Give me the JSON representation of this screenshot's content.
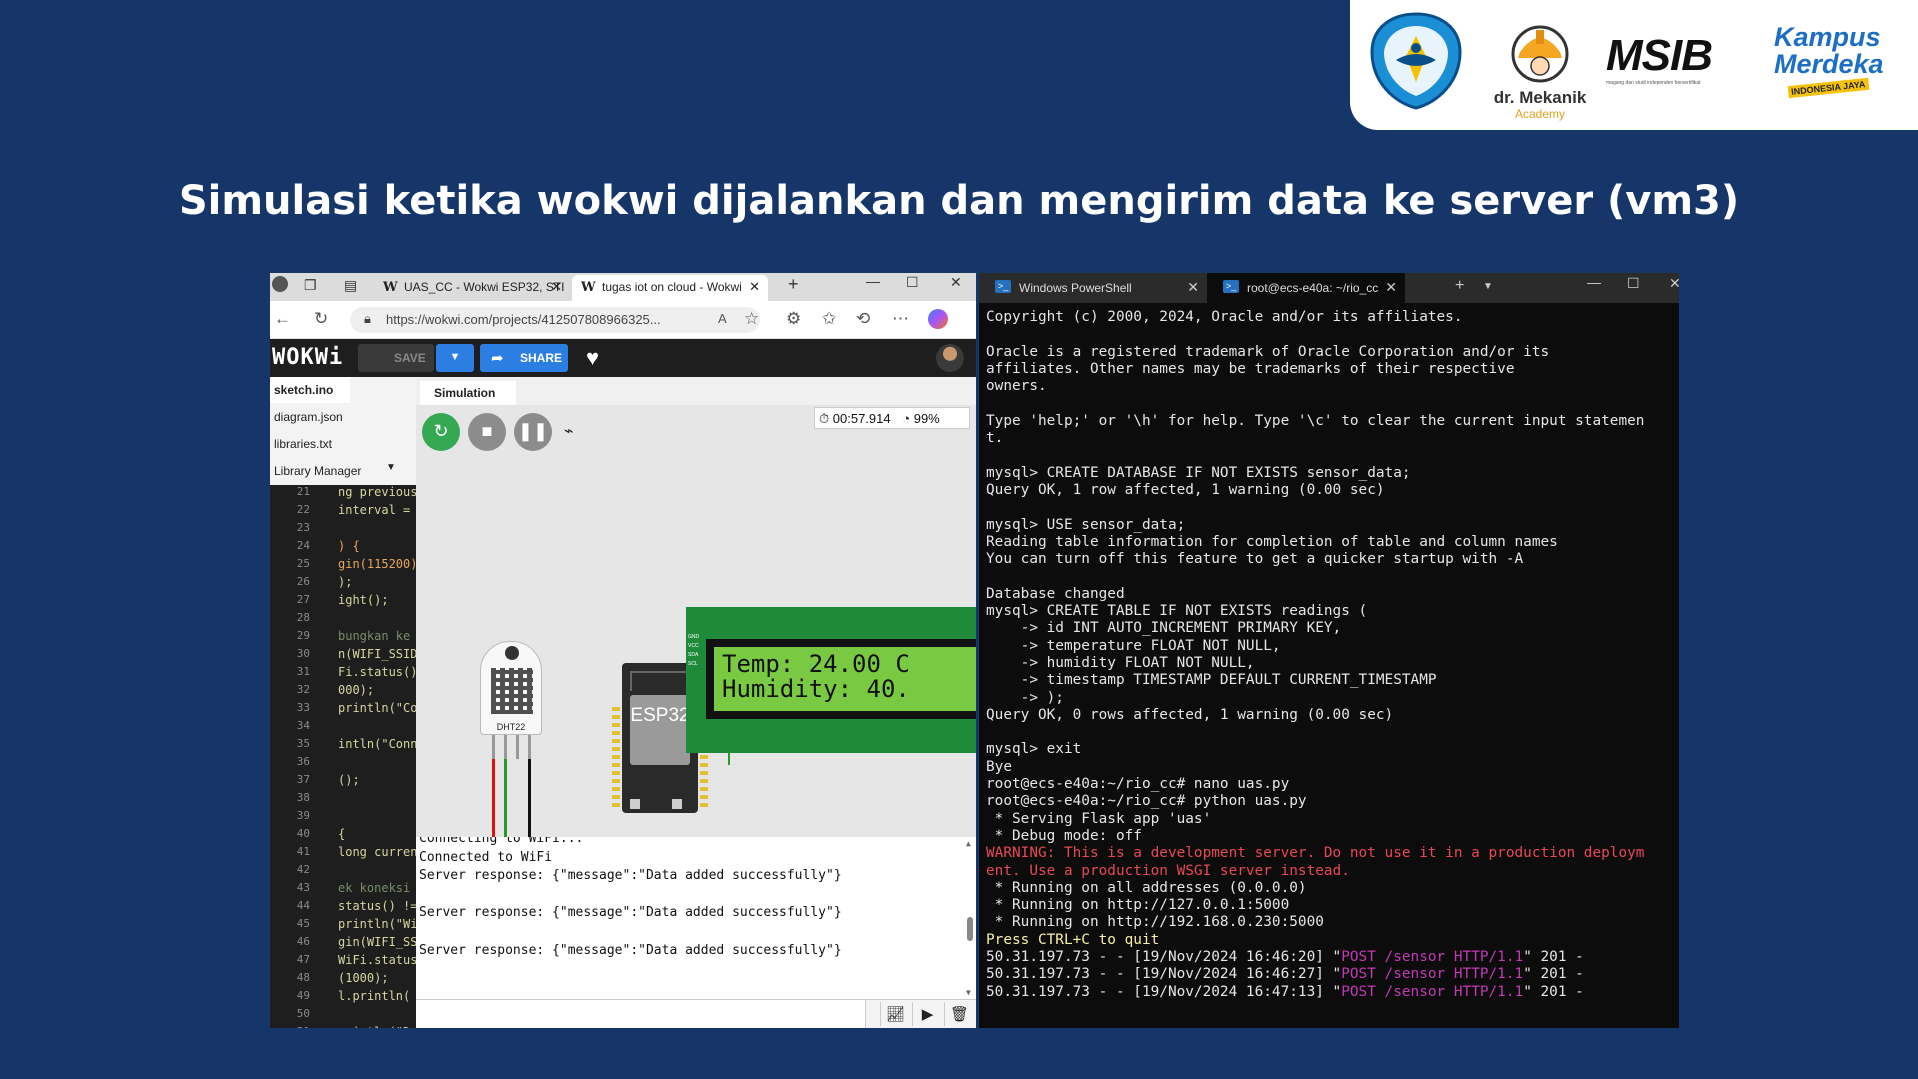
{
  "logos": {
    "tut_wuri": "Tut Wuri Handayani",
    "drmekanik_name": "dr. Mekanik",
    "drmekanik_sub": "Academy",
    "msib": "MSIB",
    "msib_sub": "magang dan studi independen bersertifikat",
    "km_line1": "Kampus",
    "km_line2": "Merdeka",
    "km_line3": "INDONESIA JAYA"
  },
  "slide_title": "Simulasi ketika wokwi dijalankan dan mengirim data ke server (vm3)",
  "browser": {
    "tabs": [
      {
        "label": "UAS_CC - Wokwi ESP32, STI",
        "active": false
      },
      {
        "label": "tugas iot on cloud - Wokwi",
        "active": true
      }
    ],
    "url": "https://wokwi.com/projects/412507808966325...",
    "wokwi": {
      "logo": "WOKWi",
      "save_label": "SAVE",
      "share_label": "SHARE",
      "files": [
        "sketch.ino",
        "diagram.json",
        "libraries.txt",
        "Library Manager"
      ],
      "sim_tab": "Simulation",
      "timer": "00:57.914",
      "speed": "99%",
      "code_lines": [
        {
          "n": "21",
          "t": "ng previous",
          "s": ""
        },
        {
          "n": "22",
          "t": "interval =",
          "s": ""
        },
        {
          "n": "23",
          "t": "",
          "s": ""
        },
        {
          "n": "24",
          "t": ") {",
          "s": "k"
        },
        {
          "n": "25",
          "t": "gin(115200)",
          "s": "k"
        },
        {
          "n": "26",
          "t": ");",
          "s": ""
        },
        {
          "n": "27",
          "t": "ight();",
          "s": ""
        },
        {
          "n": "28",
          "t": "",
          "s": ""
        },
        {
          "n": "29",
          "t": "bungkan ke",
          "s": "c"
        },
        {
          "n": "30",
          "t": "n(WIFI_SSID",
          "s": ""
        },
        {
          "n": "31",
          "t": "Fi.status()",
          "s": ""
        },
        {
          "n": "32",
          "t": "000);",
          "s": ""
        },
        {
          "n": "33",
          "t": "println(\"Co",
          "s": ""
        },
        {
          "n": "34",
          "t": "",
          "s": ""
        },
        {
          "n": "35",
          "t": "intln(\"Conn",
          "s": ""
        },
        {
          "n": "36",
          "t": "",
          "s": ""
        },
        {
          "n": "37",
          "t": "();",
          "s": ""
        },
        {
          "n": "38",
          "t": "",
          "s": ""
        },
        {
          "n": "39",
          "t": "",
          "s": ""
        },
        {
          "n": "40",
          "t": " {",
          "s": ""
        },
        {
          "n": "41",
          "t": "long curren",
          "s": ""
        },
        {
          "n": "42",
          "t": "",
          "s": ""
        },
        {
          "n": "43",
          "t": "ek koneksi",
          "s": "c"
        },
        {
          "n": "44",
          "t": "status() !=",
          "s": ""
        },
        {
          "n": "45",
          "t": "println(\"Wi",
          "s": ""
        },
        {
          "n": "46",
          "t": "gin(WIFI_SS",
          "s": ""
        },
        {
          "n": "47",
          "t": "WiFi.status",
          "s": ""
        },
        {
          "n": "48",
          "t": "(1000);",
          "s": ""
        },
        {
          "n": "49",
          "t": "l.println(",
          "s": ""
        },
        {
          "n": "50",
          "t": "",
          "s": ""
        },
        {
          "n": "51",
          "t": "println(\"D",
          "s": ""
        }
      ],
      "dht_label": "DHT22",
      "esp_label": "ESP32",
      "lcd_line1": "Temp: 24.00 C",
      "lcd_line2": "Humidity: 40.",
      "lcd_pins": [
        "GND",
        "VCC",
        "SDA",
        "SCL"
      ],
      "serial_lines": [
        "Connecting to WiFi...",
        "Connected to WiFi",
        "Server response: {\"message\":\"Data added successfully\"}",
        "",
        "Server response: {\"message\":\"Data added successfully\"}",
        "",
        "Server response: {\"message\":\"Data added successfully\"}"
      ]
    }
  },
  "terminal": {
    "tabs": [
      {
        "label": "Windows PowerShell",
        "active": false
      },
      {
        "label": "root@ecs-e40a: ~/rio_cc",
        "active": true
      }
    ],
    "lines": [
      [
        [
          "Copyright (c) 2000, 2024, Oracle and/or its affiliates.",
          ""
        ]
      ],
      [
        [
          "",
          ""
        ]
      ],
      [
        [
          "Oracle is a registered trademark of Oracle Corporation and/or its",
          ""
        ]
      ],
      [
        [
          "affiliates. Other names may be trademarks of their respective",
          ""
        ]
      ],
      [
        [
          "owners.",
          ""
        ]
      ],
      [
        [
          "",
          ""
        ]
      ],
      [
        [
          "Type 'help;' or '\\h' for help. Type '\\c' to clear the current input statemen",
          ""
        ]
      ],
      [
        [
          "t.",
          ""
        ]
      ],
      [
        [
          "",
          ""
        ]
      ],
      [
        [
          "mysql> CREATE DATABASE IF NOT EXISTS sensor_data;",
          ""
        ]
      ],
      [
        [
          "Query OK, 1 row affected, 1 warning (0.00 sec)",
          ""
        ]
      ],
      [
        [
          "",
          ""
        ]
      ],
      [
        [
          "mysql> USE sensor_data;",
          ""
        ]
      ],
      [
        [
          "Reading table information for completion of table and column names",
          ""
        ]
      ],
      [
        [
          "You can turn off this feature to get a quicker startup with -A",
          ""
        ]
      ],
      [
        [
          "",
          ""
        ]
      ],
      [
        [
          "Database changed",
          ""
        ]
      ],
      [
        [
          "mysql> CREATE TABLE IF NOT EXISTS readings (",
          ""
        ]
      ],
      [
        [
          "    -> id INT AUTO_INCREMENT PRIMARY KEY,",
          ""
        ]
      ],
      [
        [
          "    -> temperature FLOAT NOT NULL,",
          ""
        ]
      ],
      [
        [
          "    -> humidity FLOAT NOT NULL,",
          ""
        ]
      ],
      [
        [
          "    -> timestamp TIMESTAMP DEFAULT CURRENT_TIMESTAMP",
          ""
        ]
      ],
      [
        [
          "    -> );",
          ""
        ]
      ],
      [
        [
          "Query OK, 0 rows affected, 1 warning (0.00 sec)",
          ""
        ]
      ],
      [
        [
          "",
          ""
        ]
      ],
      [
        [
          "mysql> exit",
          ""
        ]
      ],
      [
        [
          "Bye",
          ""
        ]
      ],
      [
        [
          "root@ecs-e40a:~/rio_cc# nano uas.py",
          ""
        ]
      ],
      [
        [
          "root@ecs-e40a:~/rio_cc# python uas.py",
          ""
        ]
      ],
      [
        [
          " * Serving Flask app 'uas'",
          ""
        ]
      ],
      [
        [
          " * Debug mode: off",
          ""
        ]
      ],
      [
        [
          "WARNING: This is a development server. Do not use it in a production deploym",
          "red"
        ]
      ],
      [
        [
          "ent. Use a production WSGI server instead.",
          "red"
        ]
      ],
      [
        [
          " * Running on all addresses (0.0.0.0)",
          ""
        ]
      ],
      [
        [
          " * Running on http://127.0.0.1:5000",
          ""
        ]
      ],
      [
        [
          " * Running on http://192.168.0.230:5000",
          ""
        ]
      ],
      [
        [
          "Press CTRL+C to quit",
          "yel"
        ]
      ],
      [
        [
          "50.31.197.73 - - [19/Nov/2024 16:46:20] \"",
          ""
        ],
        [
          "POST /sensor HTTP/1.1",
          "mag"
        ],
        [
          "\" 201 -",
          ""
        ]
      ],
      [
        [
          "50.31.197.73 - - [19/Nov/2024 16:46:27] \"",
          ""
        ],
        [
          "POST /sensor HTTP/1.1",
          "mag"
        ],
        [
          "\" 201 -",
          ""
        ]
      ],
      [
        [
          "50.31.197.73 - - [19/Nov/2024 16:47:13] \"",
          ""
        ],
        [
          "POST /sensor HTTP/1.1",
          "mag"
        ],
        [
          "\" 201 -",
          ""
        ]
      ]
    ]
  }
}
